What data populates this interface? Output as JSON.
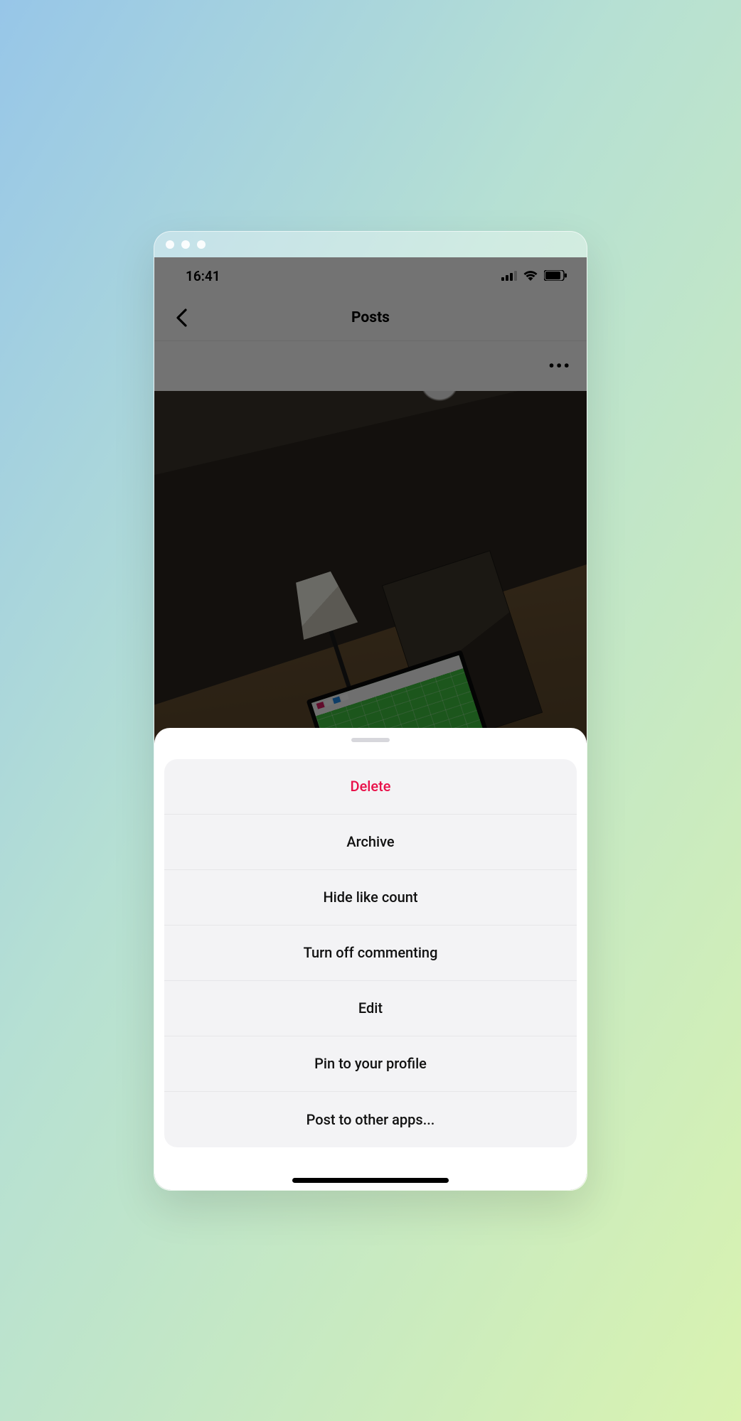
{
  "status": {
    "time": "16:41"
  },
  "header": {
    "title": "Posts"
  },
  "sheet": {
    "items": [
      {
        "label": "Delete",
        "destructive": true
      },
      {
        "label": "Archive",
        "destructive": false
      },
      {
        "label": "Hide like count",
        "destructive": false
      },
      {
        "label": "Turn off commenting",
        "destructive": false
      },
      {
        "label": "Edit",
        "destructive": false
      },
      {
        "label": "Pin to your profile",
        "destructive": false
      },
      {
        "label": "Post to other apps...",
        "destructive": false
      }
    ]
  }
}
